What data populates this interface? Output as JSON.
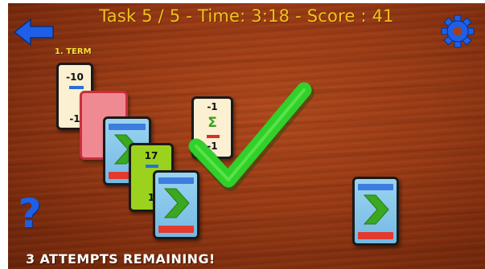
{
  "hud": {
    "task": "Task 5 / 5",
    "separator": " - ",
    "time": "Time: 3:18",
    "score": "Score : 41"
  },
  "term_label": "1. TERM",
  "attempts_text": "3 ATTEMPTS REMAINING!",
  "help_label": "?",
  "icons": {
    "back": "back-arrow-icon",
    "settings": "gear-icon",
    "success": "checkmark-icon"
  },
  "colors": {
    "hud_text": "#f2c21d",
    "button_blue": "#1f5fe6",
    "checkmark_green": "#2fd12a",
    "card_cream": "#fbf0d2",
    "card_green": "#9bd21e",
    "card_back_blue": "#8cc9ec"
  },
  "cards": {
    "term1": {
      "top": "-10",
      "bottom": "-1"
    },
    "green": {
      "top": "17",
      "bottom": "1"
    },
    "center": {
      "top": "-1",
      "bottom": "-1"
    },
    "sigma": "Σ"
  }
}
